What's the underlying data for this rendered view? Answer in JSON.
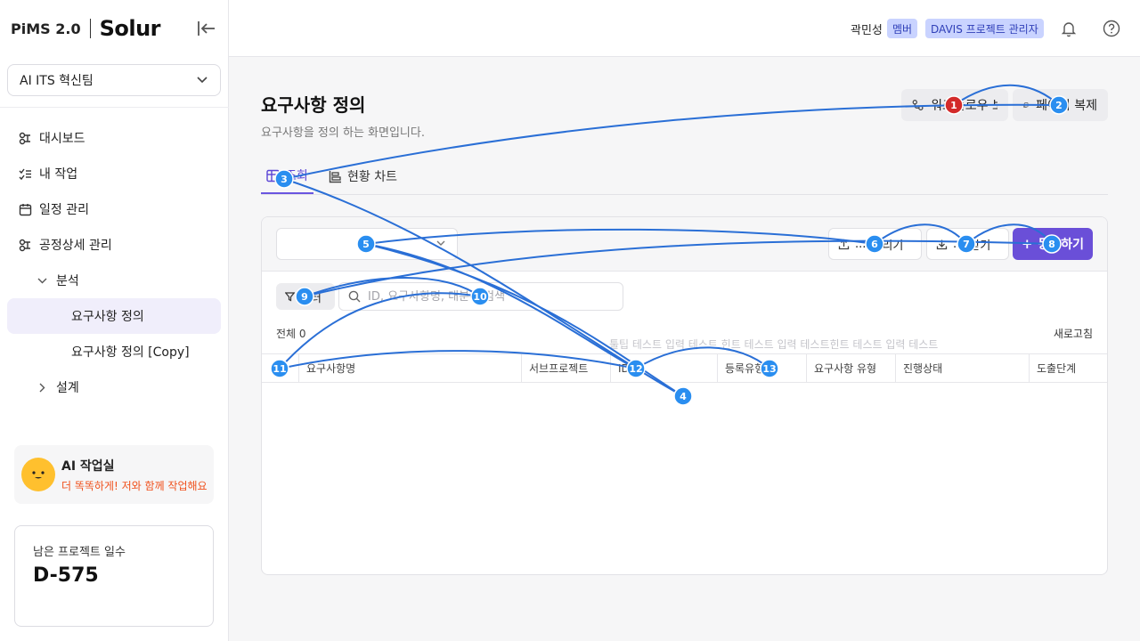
{
  "brand": {
    "product": "PiMS 2.0",
    "logo": "Solur"
  },
  "sidebar": {
    "team": "AI ITS 혁신팀",
    "items": [
      {
        "label": "대시보드",
        "icon": "dashboard-icon"
      },
      {
        "label": "내 작업",
        "icon": "task-list-icon"
      },
      {
        "label": "일정 관리",
        "icon": "calendar-icon"
      },
      {
        "label": "공정상세 관리",
        "icon": "process-icon"
      },
      {
        "label": "분석",
        "icon": "chevron-down-icon"
      },
      {
        "label": "요구사항 정의"
      },
      {
        "label": "요구사항 정의 [Copy]"
      },
      {
        "label": "설계",
        "icon": "chevron-right-icon"
      }
    ],
    "ai": {
      "title": "AI 작업실",
      "subtitle": "더 똑똑하게! 저와 함께 작업해요"
    },
    "days": {
      "label": "남은 프로젝트 일수",
      "value": "D-575"
    }
  },
  "topbar": {
    "user": "곽민성",
    "role_badge": "멤버",
    "project_badge": "DAVIS 프로젝트 관리자"
  },
  "page": {
    "title": "요구사항 정의",
    "description": "요구사항을 정의 하는 화면입니다.",
    "header_buttons": {
      "workflow": "워크플로우 보기",
      "copy": "페이지 복제"
    },
    "tabs": {
      "view": "조회",
      "chart": "현황 차트"
    }
  },
  "toolbar": {
    "upload": "올리기",
    "download": "받기",
    "register": "등록하기",
    "upload_prefix": "...",
    "download_prefix": "..."
  },
  "filter": {
    "label": "필터",
    "search_placeholder": "ID, 요구사항명, 대분류 검색"
  },
  "list": {
    "total_label": "전체",
    "total_count": "0",
    "refresh": "새로고침",
    "hint": "툴팁 테스트 입력 테스트 힌트 테스트 입력 테스트힌트 테스트 입력 테스트",
    "columns": [
      "요구사항명",
      "서브프로젝트",
      "ID",
      "등록유형",
      "요구사항 유형",
      "진행상태",
      "도출단계"
    ]
  },
  "annotations": [
    "1",
    "2",
    "3",
    "4",
    "5",
    "6",
    "7",
    "8",
    "9",
    "10",
    "11",
    "12",
    "13"
  ],
  "colors": {
    "accent": "#6a4fd8",
    "badge_bg": "#c9d3ff",
    "annotation": "#2a8ef0",
    "annotation_red": "#d32a2a",
    "ai_subtitle": "#f0511d"
  }
}
